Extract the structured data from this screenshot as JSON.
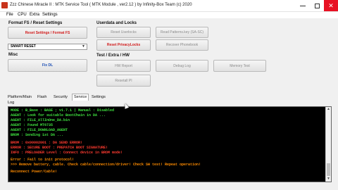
{
  "window": {
    "title": "Zzz Chinese Miracle II : MTK Service Tool ( MTK Module , ver2.12 ) by Infinity-Box Team (c) 2020"
  },
  "menu": [
    "File",
    "CPU",
    "Extra",
    "Settings"
  ],
  "format_section": {
    "title": "Format FS / Reset Settings",
    "button": "Reset Settings / Format FS",
    "select_value": "SMART RESET"
  },
  "userdata_section": {
    "title": "Userdata and Locks",
    "buttons": [
      "Reset Userlocks",
      "Read Patterns.key (SA-SC)",
      "Reset PrivacyLocks",
      "Recover Phonebook"
    ]
  },
  "misc_section": {
    "title": "Misc",
    "button": "Fix DL"
  },
  "test_section": {
    "title": "Test / Extra / HW",
    "buttons": [
      "HW Report",
      "Debug Log",
      "Memory Test",
      "Resetall PI"
    ]
  },
  "tabs": [
    "Platform/Main",
    "Flash",
    "Security",
    "Service",
    "Settings"
  ],
  "active_tab": "Service",
  "log": {
    "label": "Log",
    "lines": [
      {
        "text": "MODE : B_Base : BASE ; v1.7.1 | Manual : Disabled",
        "color": "green"
      },
      {
        "text": "AGENT : Look for suitable BootChain in DA ...",
        "color": "green"
      },
      {
        "text": "AGENT : FILE_AllInOne_DA.bin",
        "color": "green"
      },
      {
        "text": "AGENT : Found MT6735",
        "color": "green"
      },
      {
        "text": "AGENT : FILE_DOWNLOAD_AGENT",
        "color": "green"
      },
      {
        "text": "    BROM : Sending 1st DA ...",
        "color": "green"
      },
      {
        "text": "BROM : 0x00002001 : DA SEND ERROR!",
        "color": "red"
      },
      {
        "text": "ERROR : SECURE BOOT : PREPATCH BOOT SIGNATURE!",
        "color": "red"
      },
      {
        "text": "INFO : PRELOADER Level : Connect device in BROM mode!",
        "color": "red"
      },
      {
        "text": "Error : Fail to init protocol!",
        "color": "orange"
      },
      {
        "text": ">>> Remove battery, cable. Check cable/connection/driver! Check SW test! Repeat operation!",
        "color": "orange"
      },
      {
        "text": "Reconnect Power/Cable!",
        "color": "orange"
      }
    ]
  }
}
